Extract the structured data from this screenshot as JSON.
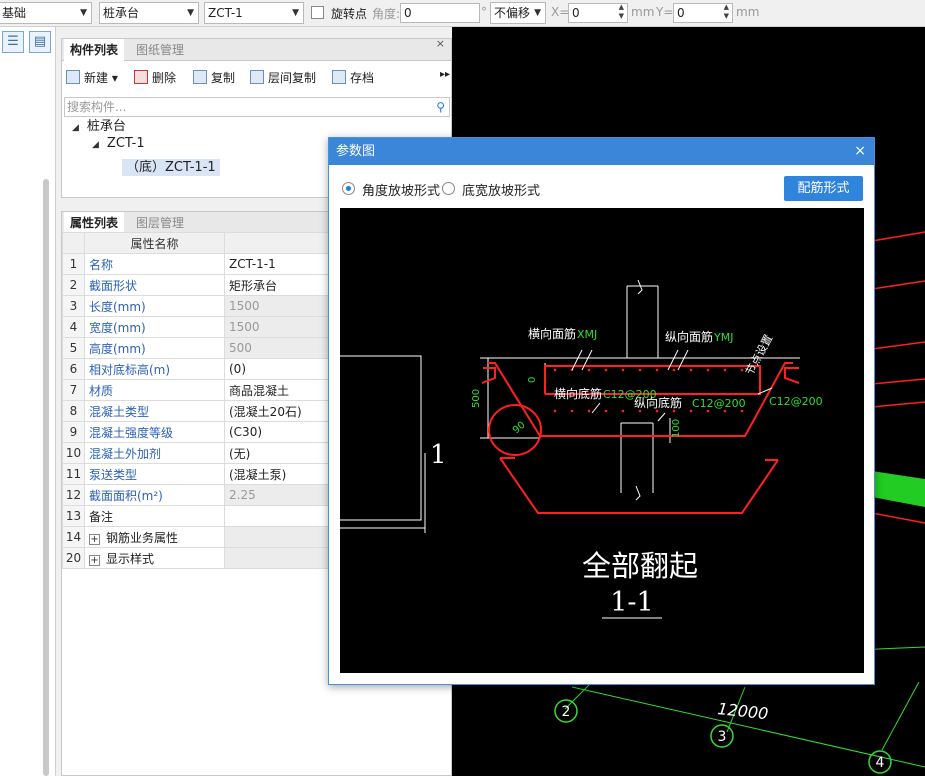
{
  "toolbar": {
    "floor": "基础",
    "category": "桩承台",
    "component": "ZCT-1",
    "rotate_point": "旋转点",
    "angle_label": "角度:",
    "angle_value": "0",
    "degree": "°",
    "offset": "不偏移",
    "x_label": "X=",
    "x_value": "0",
    "x_unit": "mm",
    "y_label": "Y=",
    "y_value": "0",
    "y_unit": "mm"
  },
  "component_panel": {
    "tabs": [
      "构件列表",
      "图纸管理"
    ],
    "tools": [
      "新建",
      "删除",
      "复制",
      "层间复制",
      "存档"
    ],
    "search_placeholder": "搜索构件...",
    "tree": [
      "桩承台",
      "ZCT-1",
      "（底）ZCT-1-1"
    ]
  },
  "property_panel": {
    "tabs": [
      "属性列表",
      "图层管理"
    ],
    "header": "属性名称",
    "rows": [
      {
        "n": "1",
        "name": "名称",
        "value": "ZCT-1-1"
      },
      {
        "n": "2",
        "name": "截面形状",
        "value": "矩形承台"
      },
      {
        "n": "3",
        "name": "长度(mm)",
        "value": "1500"
      },
      {
        "n": "4",
        "name": "宽度(mm)",
        "value": "1500"
      },
      {
        "n": "5",
        "name": "高度(mm)",
        "value": "500"
      },
      {
        "n": "6",
        "name": "相对底标高(m)",
        "value": "(0)"
      },
      {
        "n": "7",
        "name": "材质",
        "value": "商品混凝土"
      },
      {
        "n": "8",
        "name": "混凝土类型",
        "value": "(混凝土20石)"
      },
      {
        "n": "9",
        "name": "混凝土强度等级",
        "value": "(C30)"
      },
      {
        "n": "10",
        "name": "混凝土外加剂",
        "value": "(无)"
      },
      {
        "n": "11",
        "name": "泵送类型",
        "value": "(混凝土泵)"
      },
      {
        "n": "12",
        "name": "截面面积(m²)",
        "value": "2.25"
      },
      {
        "n": "13",
        "name": "备注",
        "value": ""
      },
      {
        "n": "14",
        "name": "钢筋业务属性",
        "value": ""
      },
      {
        "n": "20",
        "name": "显示样式",
        "value": ""
      }
    ]
  },
  "dialog": {
    "title": "参数图",
    "close": "×",
    "radio1": "角度放坡形式",
    "radio2": "底宽放坡形式",
    "button": "配筋形式"
  },
  "drawing": {
    "label_top_h": "横向面筋",
    "label_top_h_code": "XMJ",
    "label_top_v": "纵向面筋",
    "label_top_v_code": "YMJ",
    "label_node": "节点设置",
    "label_bot_h": "横向底筋",
    "label_bot_h_val": "C12@200",
    "label_bot_v": "纵向底筋",
    "label_bot_v_val": "C12@200",
    "label_side": "C12@200",
    "dim_500": "500",
    "dim_0": "0",
    "dim_100": "100",
    "angle_90": "90",
    "mark_1": "1",
    "title": "全部翻起",
    "section": "1-1"
  },
  "canvas": {
    "dim_12000": "12000",
    "axis_2": "2",
    "axis_3": "3",
    "axis_4": "4"
  },
  "colors": {
    "accent": "#2f84dc",
    "rebar_red": "#ff2020",
    "rebar_label_green": "#33dd33",
    "slab_green": "#22cc22"
  }
}
